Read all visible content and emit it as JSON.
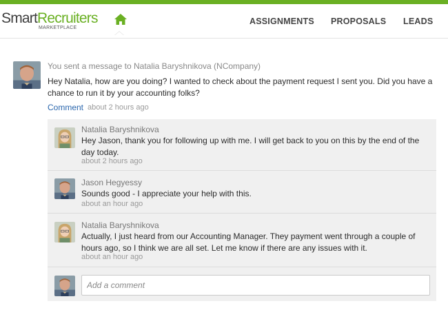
{
  "brand": {
    "logo_part1": "Smart",
    "logo_part2": "Recruiters",
    "logo_sub": "MARKETPLACE"
  },
  "nav": {
    "assignments": "ASSIGNMENTS",
    "proposals": "PROPOSALS",
    "leads": "LEADS"
  },
  "colors": {
    "brand_green": "#6ab023",
    "link_blue": "#2a66ad",
    "panel_bg": "#f0f0f0"
  },
  "message": {
    "header": "You sent a message to Natalia Baryshnikova (NCompany)",
    "text": "Hey Natalia, how are you doing? I wanted to check about the payment request I sent you. Did you have a chance to run it by your accounting folks?",
    "comment_link": "Comment",
    "time": "about 2 hours ago"
  },
  "replies": [
    {
      "author": "Natalia Baryshnikova",
      "text": "Hey Jason, thank you for following up with me. I will get back to you on this by the end of the day today.",
      "time": "about 2 hours ago"
    },
    {
      "author": "Jason Hegyessy",
      "text": "Sounds good - I appreciate your help with this.",
      "time": "about an hour ago"
    },
    {
      "author": "Natalia Baryshnikova",
      "text": "Actually, I just heard from our Accounting Manager. They payment went through a couple of hours ago, so I think we are all set. Let me know if there are any issues with it.",
      "time": "about an hour ago"
    }
  ],
  "composer": {
    "placeholder": "Add a comment"
  }
}
